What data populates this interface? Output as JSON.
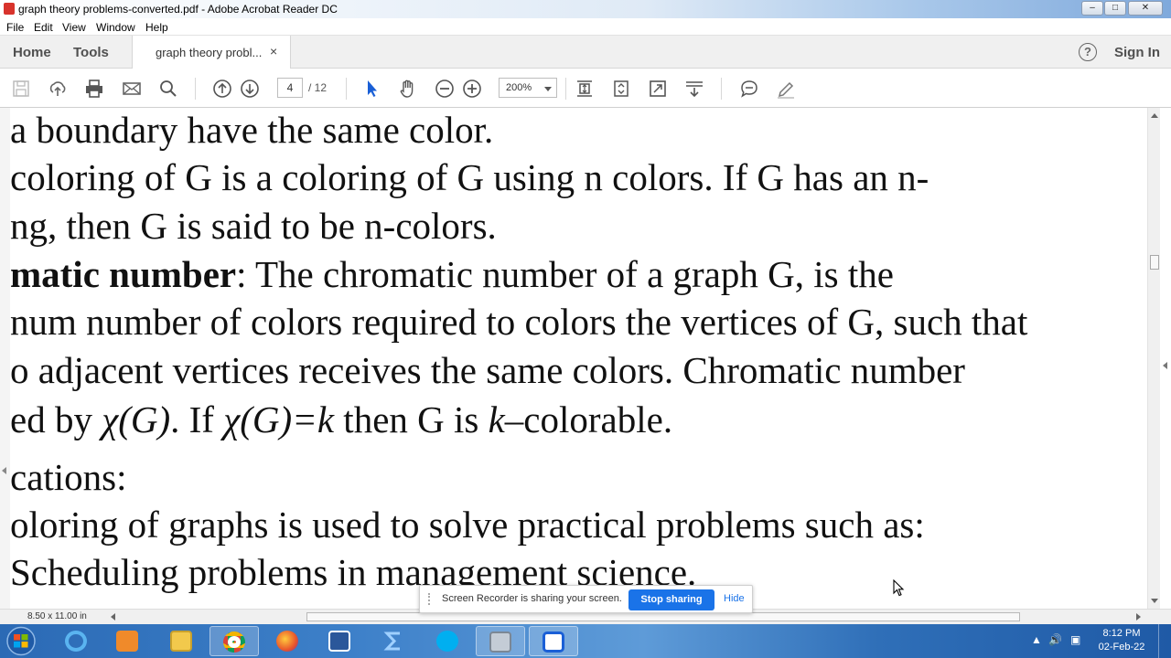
{
  "window": {
    "title": "graph theory problems-converted.pdf - Adobe Acrobat Reader DC",
    "minimize": "–",
    "maximize": "□",
    "close": "✕"
  },
  "menu": [
    "File",
    "Edit",
    "View",
    "Window",
    "Help"
  ],
  "nav": {
    "home": "Home",
    "tools": "Tools",
    "sign_in": "Sign In",
    "help": "?"
  },
  "tab": {
    "label": "graph theory probl...",
    "close": "×"
  },
  "toolbar": {
    "current_page": "4",
    "total_pages": "/ 12",
    "zoom": "200%",
    "icons": [
      "save-icon",
      "upload-icon",
      "print-icon",
      "mail-icon",
      "search-icon",
      "page-up-icon",
      "page-down-icon",
      "select-arrow-icon",
      "hand-icon",
      "zoom-out-icon",
      "zoom-in-icon",
      "fit-page-icon",
      "rotate-icon",
      "full-screen-icon",
      "read-mode-icon",
      "comment-icon",
      "sign-pen-icon"
    ]
  },
  "document": {
    "lines": [
      {
        "text": "a boundary have the same color."
      },
      {
        "text": "coloring of G is a coloring of G using n colors. If G has an n-"
      },
      {
        "text": "ng, then G is said to be n-colors."
      },
      {
        "bold": "matic number",
        "text": ": The chromatic number of a graph G, is the"
      },
      {
        "text": "num number of colors required to colors the vertices of G, such that"
      },
      {
        "text": "o adjacent vertices receives the same colors. Chromatic number"
      },
      {
        "p1": "ed by ",
        "m1": "χ(G)",
        "p2": ".  If ",
        "m2": "χ(G)=k",
        "p3": " then G is ",
        "m3": "k–",
        "p4": "colorable."
      },
      {
        "text": "cations:"
      },
      {
        "text": "oloring of graphs is used to solve practical problems such as:"
      },
      {
        "text": "Scheduling problems in management science."
      }
    ]
  },
  "status": {
    "page_size": "8.50 x 11.00 in"
  },
  "share_banner": {
    "message": "Screen Recorder is sharing your screen.",
    "stop": "Stop sharing",
    "hide": "Hide"
  },
  "taskbar": {
    "apps": [
      "internet-explorer",
      "media-player",
      "file-explorer",
      "chrome",
      "firefox",
      "word",
      "sigma-app",
      "skype",
      "screen-capture",
      "recorder"
    ],
    "time": "8:12 PM",
    "date": "02-Feb-22"
  },
  "colors": {
    "accent": "#1a73e8",
    "taskbar": "#3d80c9",
    "acrobat_red": "#d8332c"
  }
}
